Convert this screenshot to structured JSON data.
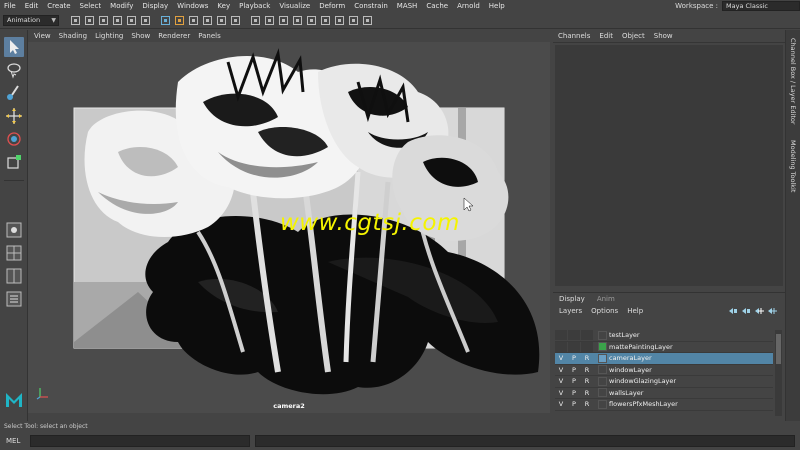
{
  "menus": [
    "File",
    "Edit",
    "Create",
    "Select",
    "Modify",
    "Display",
    "Windows",
    "Key",
    "Playback",
    "Visualize",
    "Deform",
    "Constrain",
    "MASH",
    "Cache",
    "Arnold",
    "Help"
  ],
  "workspace": {
    "label": "Workspace :",
    "value": "Maya Classic"
  },
  "status_line": {
    "mode": "Animation"
  },
  "viewport": {
    "menus": [
      "View",
      "Shading",
      "Lighting",
      "Show",
      "Renderer",
      "Panels"
    ],
    "camera_label": "camera2",
    "hud_top": "",
    "watermark": "www.cgtsj.com"
  },
  "channel_box": {
    "menus": [
      "Channels",
      "Edit",
      "Object",
      "Show"
    ]
  },
  "side_tabs": [
    "Channel Box / Layer Editor",
    "Modeling Toolkit"
  ],
  "layer_editor": {
    "tabs": [
      "Display",
      "Anim"
    ],
    "menus": [
      "Layers",
      "Options",
      "Help"
    ],
    "layers": [
      {
        "name": "testLayer",
        "v": "",
        "p": "",
        "r": "",
        "color": "#444444",
        "selected": false
      },
      {
        "name": "mattePaintingLayer",
        "v": "",
        "p": "",
        "r": "",
        "color": "#3aa34a",
        "selected": false
      },
      {
        "name": "cameraLayer",
        "v": "V",
        "p": "P",
        "r": "R",
        "color": "#6a9fc4",
        "selected": true
      },
      {
        "name": "windowLayer",
        "v": "V",
        "p": "P",
        "r": "R",
        "color": "#444444",
        "selected": false
      },
      {
        "name": "windowGlazingLayer",
        "v": "V",
        "p": "P",
        "r": "R",
        "color": "#444444",
        "selected": false
      },
      {
        "name": "wallsLayer",
        "v": "V",
        "p": "P",
        "r": "R",
        "color": "#444444",
        "selected": false
      },
      {
        "name": "flowersPfxMeshLayer",
        "v": "V",
        "p": "P",
        "r": "R",
        "color": "#444444",
        "selected": false
      }
    ]
  },
  "help_line": "Select Tool: select an object",
  "command_line": {
    "label": "MEL"
  },
  "colors": {
    "accent": "#5285a6",
    "watermark": "#f5f400",
    "maya_logo": "#1fb5c6"
  },
  "icons": [
    "select-tool-icon",
    "lasso-tool-icon",
    "paint-select-icon",
    "move-tool-icon",
    "rotate-tool-icon",
    "scale-tool-icon",
    "layout-icon",
    "maya-logo-icon",
    "axis-icon"
  ]
}
